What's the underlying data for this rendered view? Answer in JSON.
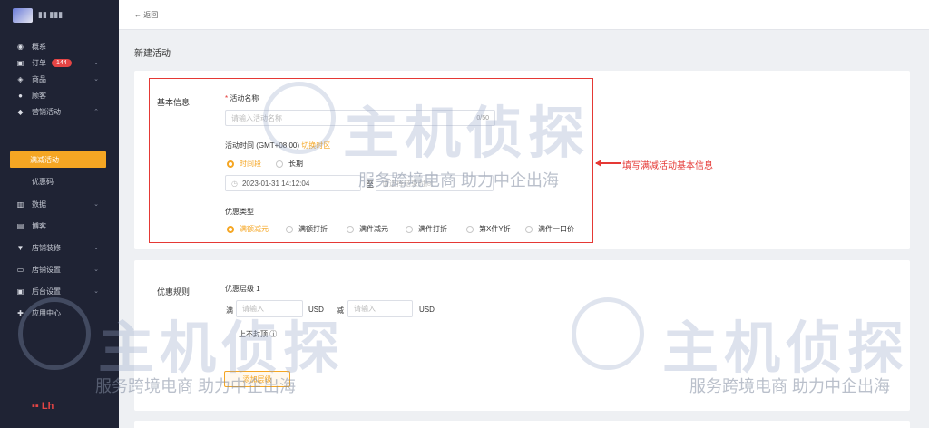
{
  "sidebar": {
    "brand": "▮▮ ▮▮▮ ·",
    "items": [
      {
        "label": "概系",
        "icon": "dashboard-icon"
      },
      {
        "label": "订单",
        "badge": "144",
        "icon": "order-icon"
      },
      {
        "label": "商品",
        "icon": "product-icon"
      },
      {
        "label": "顾客",
        "icon": "customer-icon"
      },
      {
        "label": "营销活动",
        "icon": "marketing-icon"
      },
      {
        "label": "满减活动"
      },
      {
        "label": "优惠码"
      },
      {
        "label": "数据",
        "icon": "chart-icon"
      },
      {
        "label": "博客",
        "icon": "blog-icon"
      },
      {
        "label": "店铺装修",
        "icon": "brush-icon"
      },
      {
        "label": "店铺设置",
        "icon": "store-icon"
      },
      {
        "label": "后台设置",
        "icon": "settings-icon"
      },
      {
        "label": "应用中心",
        "icon": "app-icon"
      }
    ],
    "footer_logo": "▪▪ Lh"
  },
  "topbar": {
    "back": "← 返回"
  },
  "page": {
    "title": "新建活动"
  },
  "basic": {
    "section": "基本信息",
    "name_label": "活动名称",
    "name_placeholder": "请输入活动名称",
    "name_count": "0/50",
    "time_label": "活动时间 (GMT+08:00)",
    "time_link": "切换时区",
    "time_opt1": "时间段",
    "time_opt2": "长期",
    "start_time": "2023-01-31 14:12:04",
    "to": "至",
    "end_placeholder": "请选择结束时间",
    "type_label": "优惠类型",
    "types": [
      "满额减元",
      "满额打折",
      "满件减元",
      "满件打折",
      "第X件Y折",
      "满件一口价"
    ]
  },
  "annotation": "填写满减活动基本信息",
  "rules": {
    "section": "优惠规则",
    "tier": "优惠层级 1",
    "full": "满",
    "placeholder1": "请输入",
    "usd1": "USD",
    "minus": "减",
    "placeholder2": "请输入",
    "usd2": "USD",
    "cap": "上不封顶",
    "add_button": "添加层级"
  },
  "watermark": {
    "big": "主机侦探",
    "small": "服务跨境电商 助力中企出海"
  }
}
